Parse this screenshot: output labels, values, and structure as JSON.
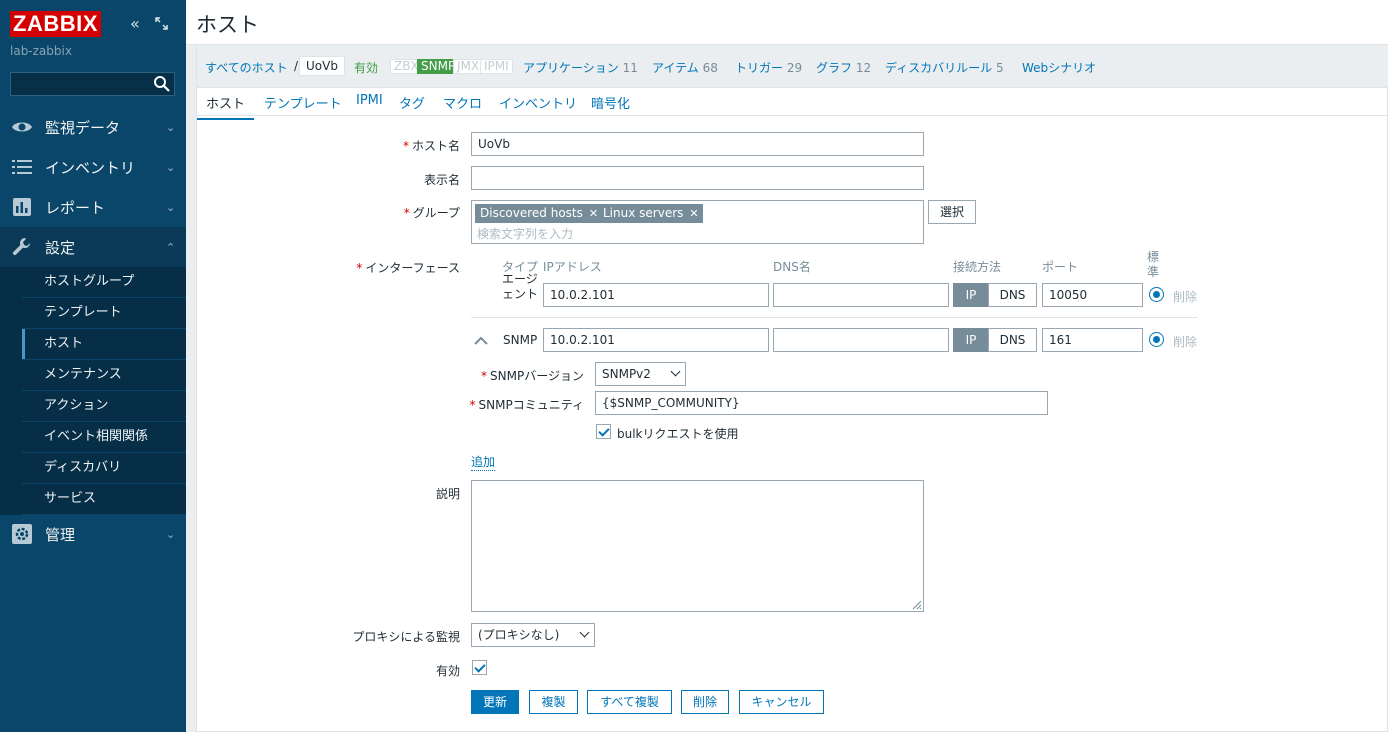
{
  "sidebar": {
    "logo": "ZABBIX",
    "server_name": "lab-zabbix",
    "search_value": "",
    "menu": [
      {
        "label": "監視データ",
        "icon": "eye-icon"
      },
      {
        "label": "インベントリ",
        "icon": "list-icon"
      },
      {
        "label": "レポート",
        "icon": "bar-chart-icon"
      },
      {
        "label": "設定",
        "icon": "wrench-icon"
      },
      {
        "label": "管理",
        "icon": "gear-icon"
      }
    ],
    "submenu": [
      "ホストグループ",
      "テンプレート",
      "ホスト",
      "メンテナンス",
      "アクション",
      "イベント相関関係",
      "ディスカバリ",
      "サービス"
    ]
  },
  "header": {
    "title": "ホスト"
  },
  "hostnav": {
    "all_hosts": "すべてのホスト",
    "separator": "/",
    "current_host": "UoVb",
    "status": "有効",
    "avail": [
      "ZBX",
      "SNMP",
      "JMX",
      "IPMI"
    ],
    "links": [
      {
        "label": "アプリケーション",
        "count": "11"
      },
      {
        "label": "アイテム",
        "count": "68"
      },
      {
        "label": "トリガー",
        "count": "29"
      },
      {
        "label": "グラフ",
        "count": "12"
      },
      {
        "label": "ディスカバリルール",
        "count": "5"
      },
      {
        "label": "Webシナリオ",
        "count": ""
      }
    ]
  },
  "tabs": [
    "ホスト",
    "テンプレート",
    "IPMI",
    "タグ",
    "マクロ",
    "インベントリ",
    "暗号化"
  ],
  "form": {
    "hostname_label": "ホスト名",
    "hostname_value": "UoVb",
    "visible_name_label": "表示名",
    "visible_name_value": "",
    "groups_label": "グループ",
    "groups": [
      "Discovered hosts",
      "Linux servers"
    ],
    "groups_placeholder": "検索文字列を入力",
    "select_button": "選択",
    "interfaces_label": "インターフェース",
    "iface_headers": {
      "type": "タイプ",
      "ip": "IPアドレス",
      "dns": "DNS名",
      "connect": "接続方法",
      "port": "ポート",
      "default": "標準"
    },
    "agent_label": "エージェント",
    "agent": {
      "ip": "10.0.2.101",
      "dns": "",
      "port": "10050"
    },
    "snmp_label": "SNMP",
    "snmp": {
      "ip": "10.0.2.101",
      "dns": "",
      "port": "161"
    },
    "ip_btn": "IP",
    "dns_btn": "DNS",
    "remove": "削除",
    "snmp_version_label": "SNMPバージョン",
    "snmp_version_value": "SNMPv2",
    "snmp_community_label": "SNMPコミュニティ",
    "snmp_community_value": "{$SNMP_COMMUNITY}",
    "bulk_label": "bulkリクエストを使用",
    "add_link": "追加",
    "description_label": "説明",
    "proxy_label": "プロキシによる監視",
    "proxy_value": "(プロキシなし)",
    "enabled_label": "有効"
  },
  "buttons": {
    "update": "更新",
    "clone": "複製",
    "full_clone": "すべて複製",
    "delete": "削除",
    "cancel": "キャンセル"
  },
  "colors": {
    "sidebar": "#0a466a",
    "accent": "#0275b8",
    "logo": "#d40000",
    "snmp_ok": "#429e47"
  }
}
